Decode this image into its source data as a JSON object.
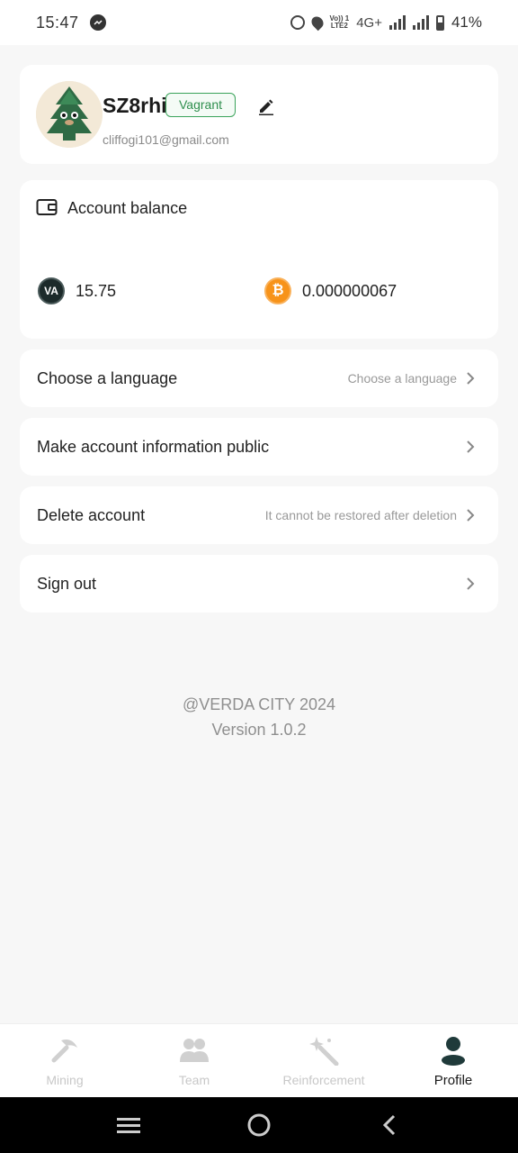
{
  "status_bar": {
    "time": "15:47",
    "network": "4G+",
    "volte": [
      "Vo)) 1",
      "LTE2"
    ],
    "battery": "41%"
  },
  "profile": {
    "username": "SZ8rhi",
    "rank": "Vagrant",
    "email": "cliffogi101@gmail.com"
  },
  "balance": {
    "title": "Account balance",
    "va_label": "VA",
    "va_value": "15.75",
    "btc_symbol": "₿",
    "btc_value": "0.000000067"
  },
  "menu": {
    "language": {
      "label": "Choose a language",
      "hint": "Choose a language"
    },
    "public": {
      "label": "Make account information public"
    },
    "delete": {
      "label": "Delete account",
      "hint": "It cannot be restored after deletion"
    },
    "signout": {
      "label": "Sign out"
    }
  },
  "footer": {
    "copyright": "@VERDA CITY 2024",
    "version": "Version 1.0.2"
  },
  "nav": {
    "mining": "Mining",
    "team": "Team",
    "reinforcement": "Reinforcement",
    "profile": "Profile"
  },
  "colors": {
    "accent_green": "#2f8f4e",
    "btc_orange": "#f7931a",
    "active_nav": "#1a1a1a",
    "inactive_nav": "#c8c8c8"
  }
}
